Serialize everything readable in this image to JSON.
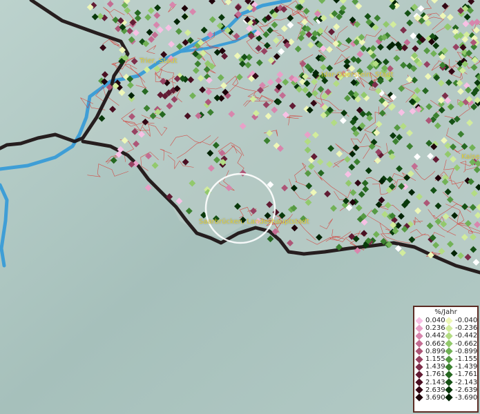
{
  "map": {
    "cities": [
      {
        "id": "trier",
        "label": "Trier, Stadt"
      },
      {
        "id": "idar",
        "label": "Idar-Oberstein, Stadt"
      },
      {
        "id": "saarbruecken",
        "label": "Saarbrücken, Landeshauptstadt"
      },
      {
        "id": "kaiser",
        "label": "Kaise"
      }
    ],
    "colors": {
      "terrain": "#a9c2bd",
      "border": "#1a0f10",
      "districts": "#d8302a",
      "rivers": "#3f9ed6",
      "highlight_circle": "#ffffff"
    }
  },
  "legend": {
    "title": "%/Jahr",
    "positive": [
      {
        "value": "0.040",
        "color": "#f7c0e4"
      },
      {
        "value": "0.236",
        "color": "#e9a0c8"
      },
      {
        "value": "0.442",
        "color": "#d886ad"
      },
      {
        "value": "0.662",
        "color": "#c36d92"
      },
      {
        "value": "0.899",
        "color": "#ad5677"
      },
      {
        "value": "1.155",
        "color": "#974262"
      },
      {
        "value": "1.439",
        "color": "#7d2e4a"
      },
      {
        "value": "1.761",
        "color": "#621c34"
      },
      {
        "value": "2.143",
        "color": "#4a0f22"
      },
      {
        "value": "2.639",
        "color": "#330714"
      },
      {
        "value": "3.690",
        "color": "#1e030a"
      }
    ],
    "negative": [
      {
        "value": "-0.040",
        "color": "#eef7b8"
      },
      {
        "value": "-0.236",
        "color": "#d2ec9c"
      },
      {
        "value": "-0.442",
        "color": "#b3dc83"
      },
      {
        "value": "-0.662",
        "color": "#92c96c"
      },
      {
        "value": "-0.899",
        "color": "#72b257"
      },
      {
        "value": "-1.155",
        "color": "#569a43"
      },
      {
        "value": "-1.439",
        "color": "#3c8130"
      },
      {
        "value": "-1.761",
        "color": "#266821"
      },
      {
        "value": "-2.143",
        "color": "#155115"
      },
      {
        "value": "-2.639",
        "color": "#09390b"
      },
      {
        "value": "-3.690",
        "color": "#022405"
      }
    ]
  }
}
